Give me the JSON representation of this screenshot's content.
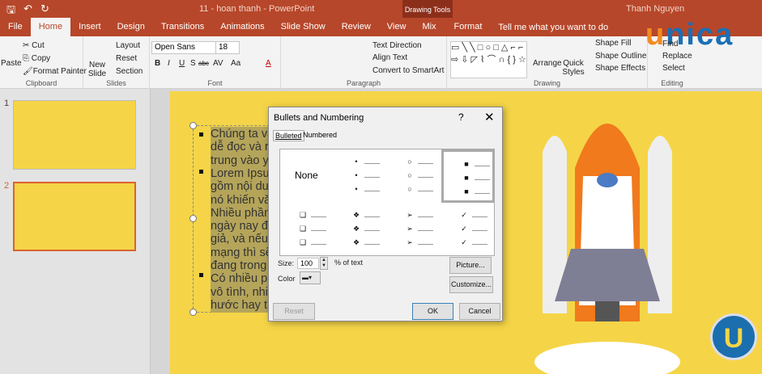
{
  "titlebar": {
    "title": "11 - hoan thanh  -  PowerPoint",
    "context_tab": "Drawing Tools",
    "user": "Thanh Nguyen"
  },
  "tabs": [
    "File",
    "Home",
    "Insert",
    "Design",
    "Transitions",
    "Animations",
    "Slide Show",
    "Review",
    "View",
    "Mix",
    "Format"
  ],
  "tell_me": "Tell me what you want to do",
  "brand": {
    "logo_prefix": "u",
    "logo_rest": "nica",
    "corner_badge": "U"
  },
  "ribbon": {
    "clipboard": {
      "paste": "Paste",
      "cut": "Cut",
      "copy": "Copy",
      "format_painter": "Format Painter",
      "label": "Clipboard"
    },
    "slides": {
      "new_slide": "New Slide",
      "layout": "Layout",
      "reset": "Reset",
      "section": "Section",
      "label": "Slides"
    },
    "font": {
      "name": "Open Sans",
      "size": "18",
      "bold": "B",
      "italic": "I",
      "underline": "U",
      "shadow": "S",
      "strike": "abc",
      "spacing": "AV",
      "case": "Aa",
      "color": "A",
      "label": "Font"
    },
    "paragraph": {
      "text_direction": "Text Direction",
      "align_text": "Align Text",
      "convert": "Convert to SmartArt",
      "label": "Paragraph"
    },
    "drawing": {
      "arrange": "Arrange",
      "quick_styles": "Quick Styles",
      "shape_fill": "Shape Fill",
      "shape_outline": "Shape Outline",
      "shape_effects": "Shape Effects",
      "label": "Drawing"
    },
    "editing": {
      "find": "Find",
      "replace": "Replace",
      "select": "Select",
      "label": "Editing"
    }
  },
  "thumbnails": [
    {
      "number": "1"
    },
    {
      "number": "2"
    }
  ],
  "slide_text": [
    "Chúng ta vẫ",
    "dễ đọc và rõ",
    "trung vào yế",
    "Lorem Ipsum",
    "gồm nội du",
    "nó khiến văn",
    "Nhiều phần",
    "ngày nay đã",
    "giả, và nếu b",
    "mạng thì sẽ",
    "đang trong",
    "Có nhiều ph",
    "vô tình, nhiề",
    "hước hay th"
  ],
  "dialog": {
    "title": "Bullets and Numbering",
    "help": "?",
    "close": "✕",
    "tabs": [
      "Bulleted",
      "Numbered"
    ],
    "none_label": "None",
    "bullets": [
      "•",
      "○",
      "■",
      "❑",
      "❖",
      "➢",
      "✓"
    ],
    "size_label": "Size:",
    "size_value": "100",
    "size_unit": "% of text",
    "color_label": "Color",
    "picture": "Picture...",
    "customize": "Customize...",
    "reset": "Reset",
    "ok": "OK",
    "cancel": "Cancel"
  },
  "colors": {
    "accent": "#b7472a",
    "slide": "#f5d547"
  }
}
